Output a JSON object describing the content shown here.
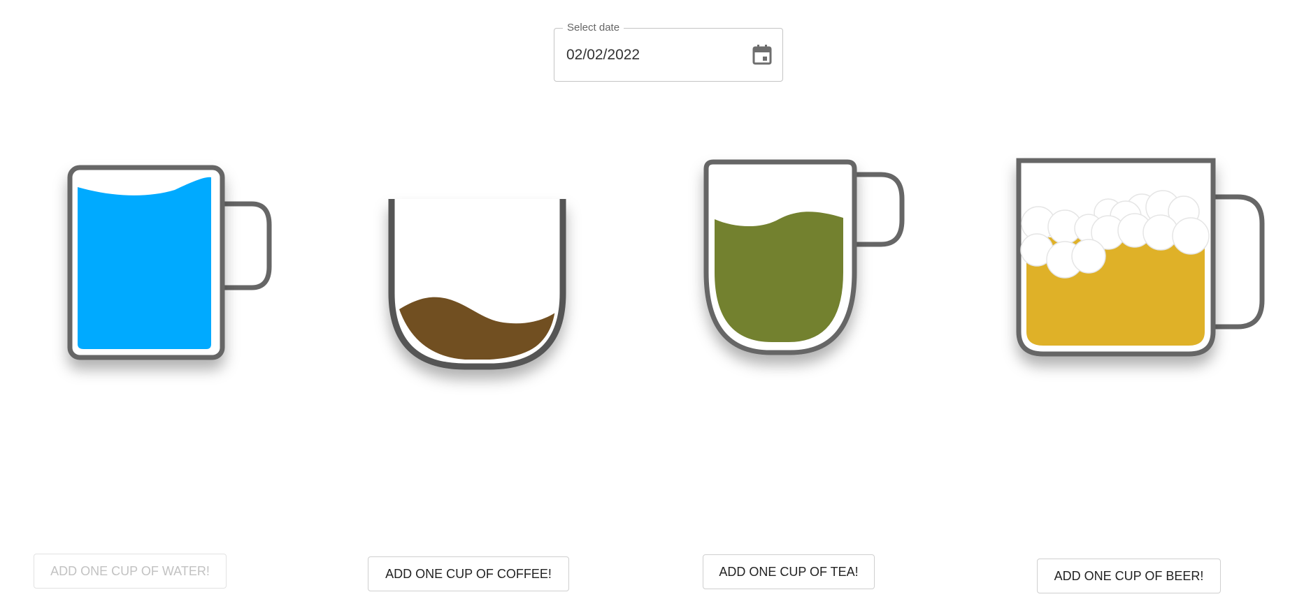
{
  "date_picker": {
    "label": "Select date",
    "value": "02/02/2022",
    "icon": "calendar-icon"
  },
  "mugs": [
    {
      "drink": "water",
      "liquid_color": "#00aaff",
      "fill_level": 0.95
    },
    {
      "drink": "coffee",
      "liquid_color": "#714f21",
      "fill_level": 0.35
    },
    {
      "drink": "tea",
      "liquid_color": "#73812f",
      "fill_level": 0.75
    },
    {
      "drink": "beer",
      "liquid_color": "#dfb128",
      "fill_level": 0.9,
      "foam_color": "#ffffff"
    }
  ],
  "buttons": {
    "water": {
      "label": "ADD ONE CUP OF WATER!",
      "disabled": true
    },
    "coffee": {
      "label": "ADD ONE CUP OF COFFEE!",
      "disabled": false
    },
    "tea": {
      "label": "ADD ONE CUP OF TEA!",
      "disabled": false
    },
    "beer": {
      "label": "ADD ONE CUP OF BEER!",
      "disabled": false
    }
  },
  "colors": {
    "mug_outline": "#666666",
    "mug_shadow": "#555555",
    "field_border": "#c4c4c4",
    "disabled_text": "#c2c2c2"
  }
}
